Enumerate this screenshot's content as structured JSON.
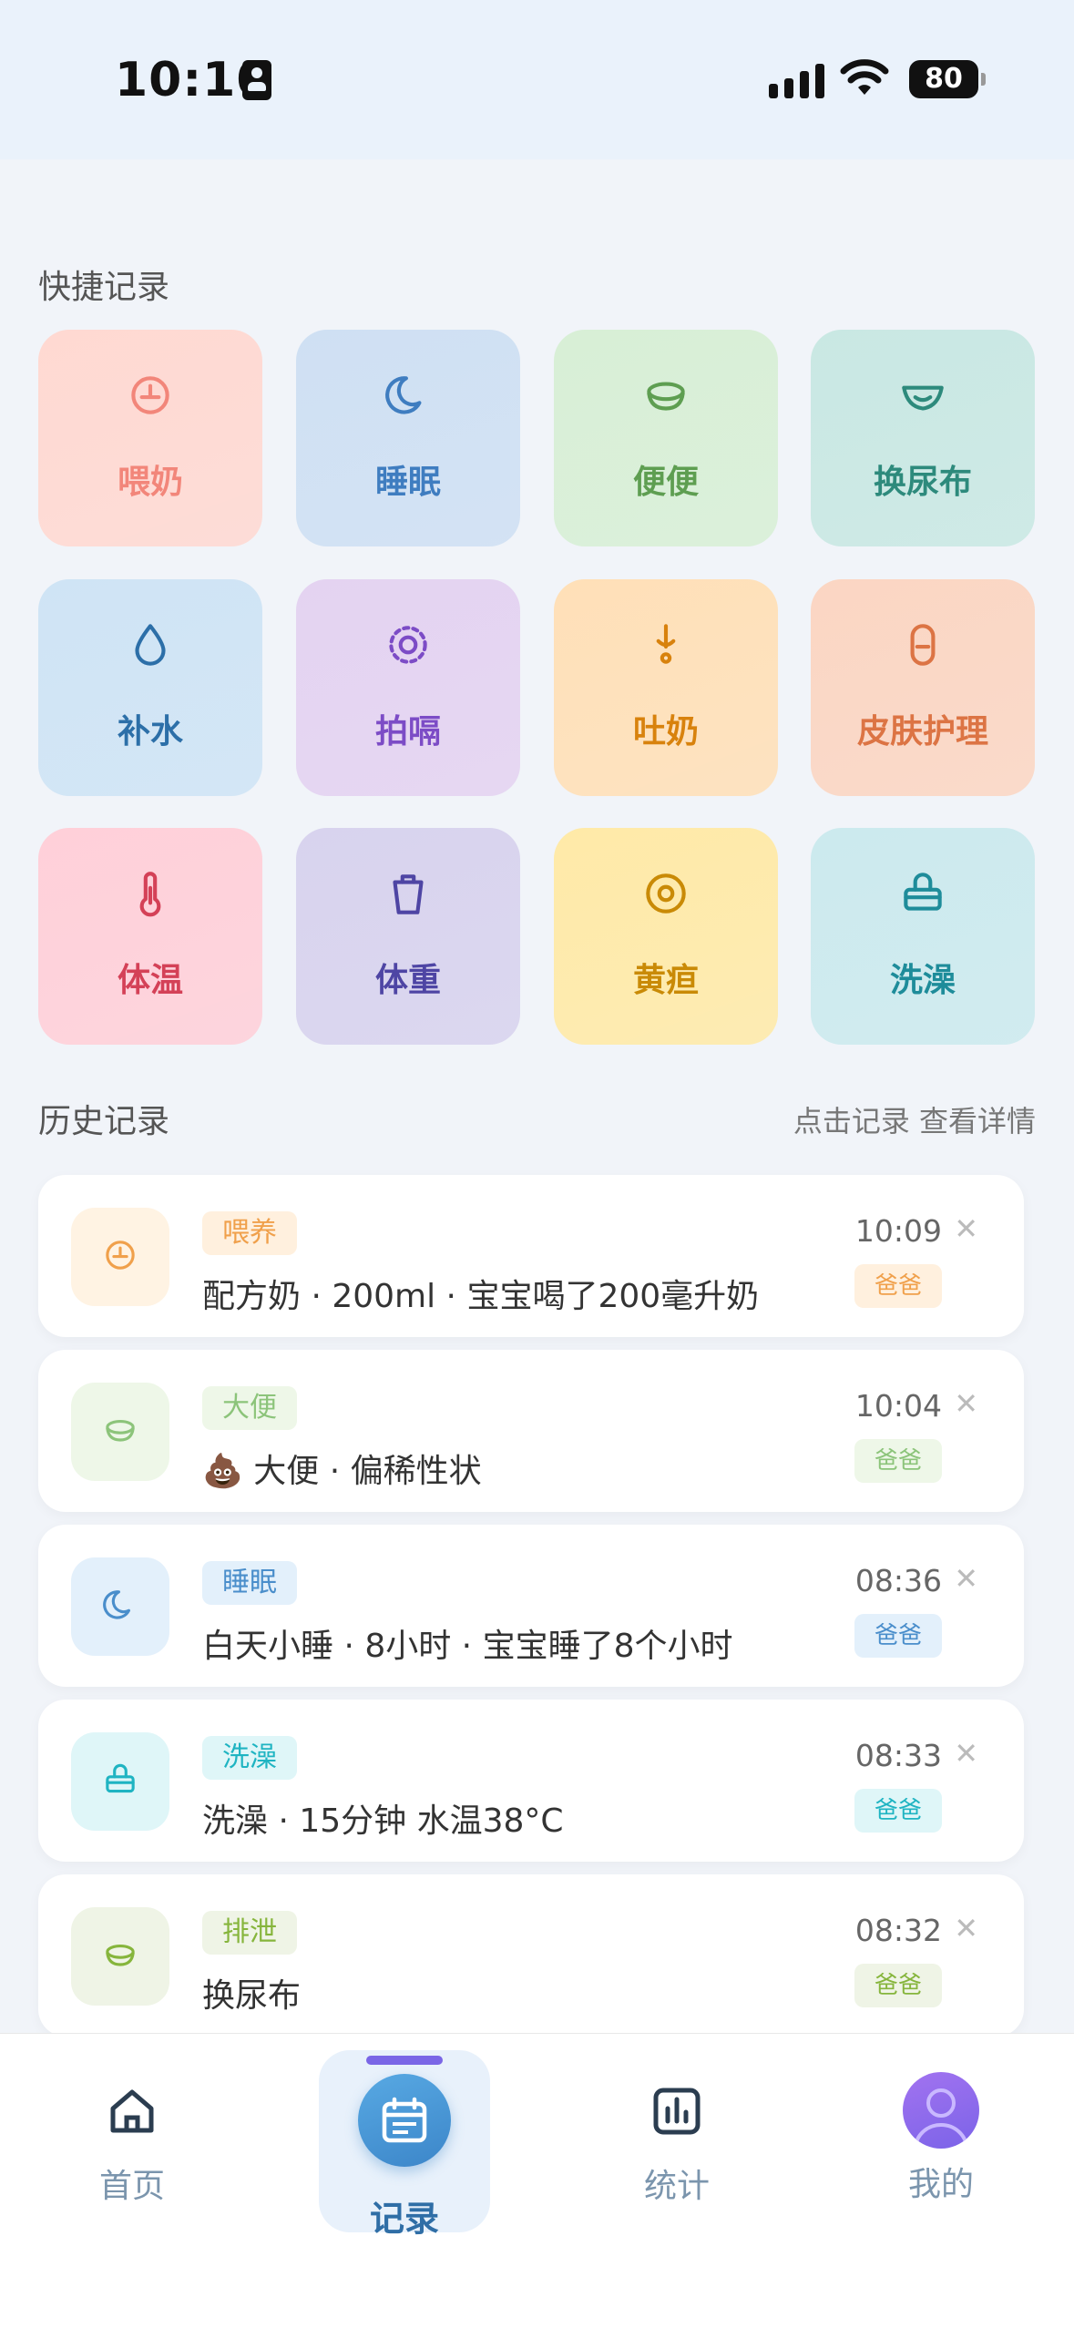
{
  "status_bar": {
    "time": "10:10",
    "battery": "80"
  },
  "quick": {
    "title": "快捷记录",
    "tiles": [
      {
        "label": "喂奶",
        "icon": "clock-icon",
        "color": "#f2867a",
        "bg": "#ffd9d2"
      },
      {
        "label": "睡眠",
        "icon": "moon-icon",
        "color": "#3f7dc0",
        "bg": "#cfe0f3"
      },
      {
        "label": "便便",
        "icon": "bowl-icon",
        "color": "#5e9e51",
        "bg": "#d8efd6"
      },
      {
        "label": "换尿布",
        "icon": "diaper-icon",
        "color": "#2d8a7c",
        "bg": "#c9e8e3"
      },
      {
        "label": "补水",
        "icon": "drop-icon",
        "color": "#2c6fa8",
        "bg": "#cfe4f5"
      },
      {
        "label": "拍嗝",
        "icon": "burp-icon",
        "color": "#7c4cc6",
        "bg": "#e4d3f1"
      },
      {
        "label": "吐奶",
        "icon": "spit-icon",
        "color": "#d8820d",
        "bg": "#ffe0b8"
      },
      {
        "label": "皮肤护理",
        "icon": "lotion-icon",
        "color": "#dc7444",
        "bg": "#fbd6c3"
      },
      {
        "label": "体温",
        "icon": "thermometer-icon",
        "color": "#d44157",
        "bg": "#ffd0d9"
      },
      {
        "label": "体重",
        "icon": "scale-icon",
        "color": "#4e45a4",
        "bg": "#d8d3ee"
      },
      {
        "label": "黄疸",
        "icon": "target-icon",
        "color": "#c98a06",
        "bg": "#ffeaa8"
      },
      {
        "label": "洗澡",
        "icon": "bath-icon",
        "color": "#1e8c9a",
        "bg": "#cceaee"
      }
    ]
  },
  "history": {
    "title": "历史记录",
    "hint": "点击记录 查看详情",
    "records": [
      {
        "tag": "喂养",
        "desc": "配方奶 · 200ml · 宝宝喝了200毫升奶",
        "time": "10:09",
        "who": "爸爸",
        "icon": "clock-icon",
        "color": "#f0a04b",
        "tag_bg": "#fff0de",
        "icon_bg": "#fff3e3"
      },
      {
        "tag": "大便",
        "desc": "💩 大便 · 偏稀性状",
        "time": "10:04",
        "who": "爸爸",
        "icon": "bowl-icon",
        "color": "#8cc47a",
        "tag_bg": "#eef7e8",
        "icon_bg": "#eef7e8"
      },
      {
        "tag": "睡眠",
        "desc": "白天小睡 · 8小时 · 宝宝睡了8个小时",
        "time": "08:36",
        "who": "爸爸",
        "icon": "moon-icon",
        "color": "#4a8ecb",
        "tag_bg": "#e3f0fb",
        "icon_bg": "#e3f0fb"
      },
      {
        "tag": "洗澡",
        "desc": "洗澡 · 15分钟 水温38°C",
        "time": "08:33",
        "who": "爸爸",
        "icon": "bath-icon",
        "color": "#1fb4c2",
        "tag_bg": "#dff6f8",
        "icon_bg": "#dff6f8"
      },
      {
        "tag": "排泄",
        "desc": "换尿布",
        "time": "08:32",
        "who": "爸爸",
        "icon": "bowl-icon",
        "color": "#86b53c",
        "tag_bg": "#eff4e6",
        "icon_bg": "#eff4e6"
      }
    ]
  },
  "tabbar": {
    "home": "首页",
    "record": "记录",
    "stats": "统计",
    "mine": "我的"
  }
}
